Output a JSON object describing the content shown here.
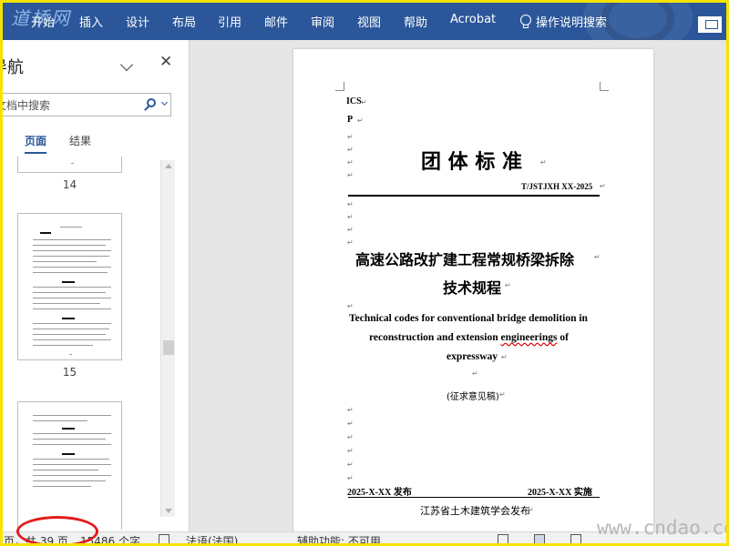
{
  "watermark_logo": "道桥网",
  "ribbon": {
    "tabs": [
      "开始",
      "插入",
      "设计",
      "布局",
      "引用",
      "邮件",
      "审阅",
      "视图",
      "帮助",
      "Acrobat"
    ],
    "tell_me": "操作说明搜索"
  },
  "nav_pane": {
    "title": "导航",
    "search_placeholder": "搜索文档",
    "search_text": "文档中搜索",
    "tabs": [
      "页面",
      "结果"
    ],
    "active_tab": "页面",
    "thumbnail_page_numbers": [
      "14",
      "15"
    ]
  },
  "document": {
    "ics_label": "ICS",
    "p_label": "P",
    "standard_type": "团 体 标 准",
    "standard_code": "T/JSTJXH XX-2025",
    "title_cn_line1": "高速公路改扩建工程常规桥梁拆除",
    "title_cn_line2": "技术规程",
    "title_en_line1": "Technical codes for conventional bridge demolition in",
    "title_en_line2_a": "reconstruction and extension ",
    "title_en_line2_b": "engineerings",
    "title_en_line2_c": " of",
    "title_en_line3": "expressway",
    "draft_note": "(征求意见稿)",
    "publish_date": "2025-X-XX  发布",
    "implement_date": "2025-X-XX  实施",
    "publisher": "江苏省土木建筑学会发布",
    "paragraph_mark": "↵"
  },
  "status_bar": {
    "page_info": "页，共 39 页",
    "word_count": "15486 个字",
    "language": "法语(法国)",
    "accessibility": "辅助功能: 不可用"
  },
  "site_watermark": "www.cndao.com",
  "colors": {
    "ribbon": "#2b579a",
    "frame": "#f6e300",
    "annotation_ellipse": "#e21b1b"
  }
}
